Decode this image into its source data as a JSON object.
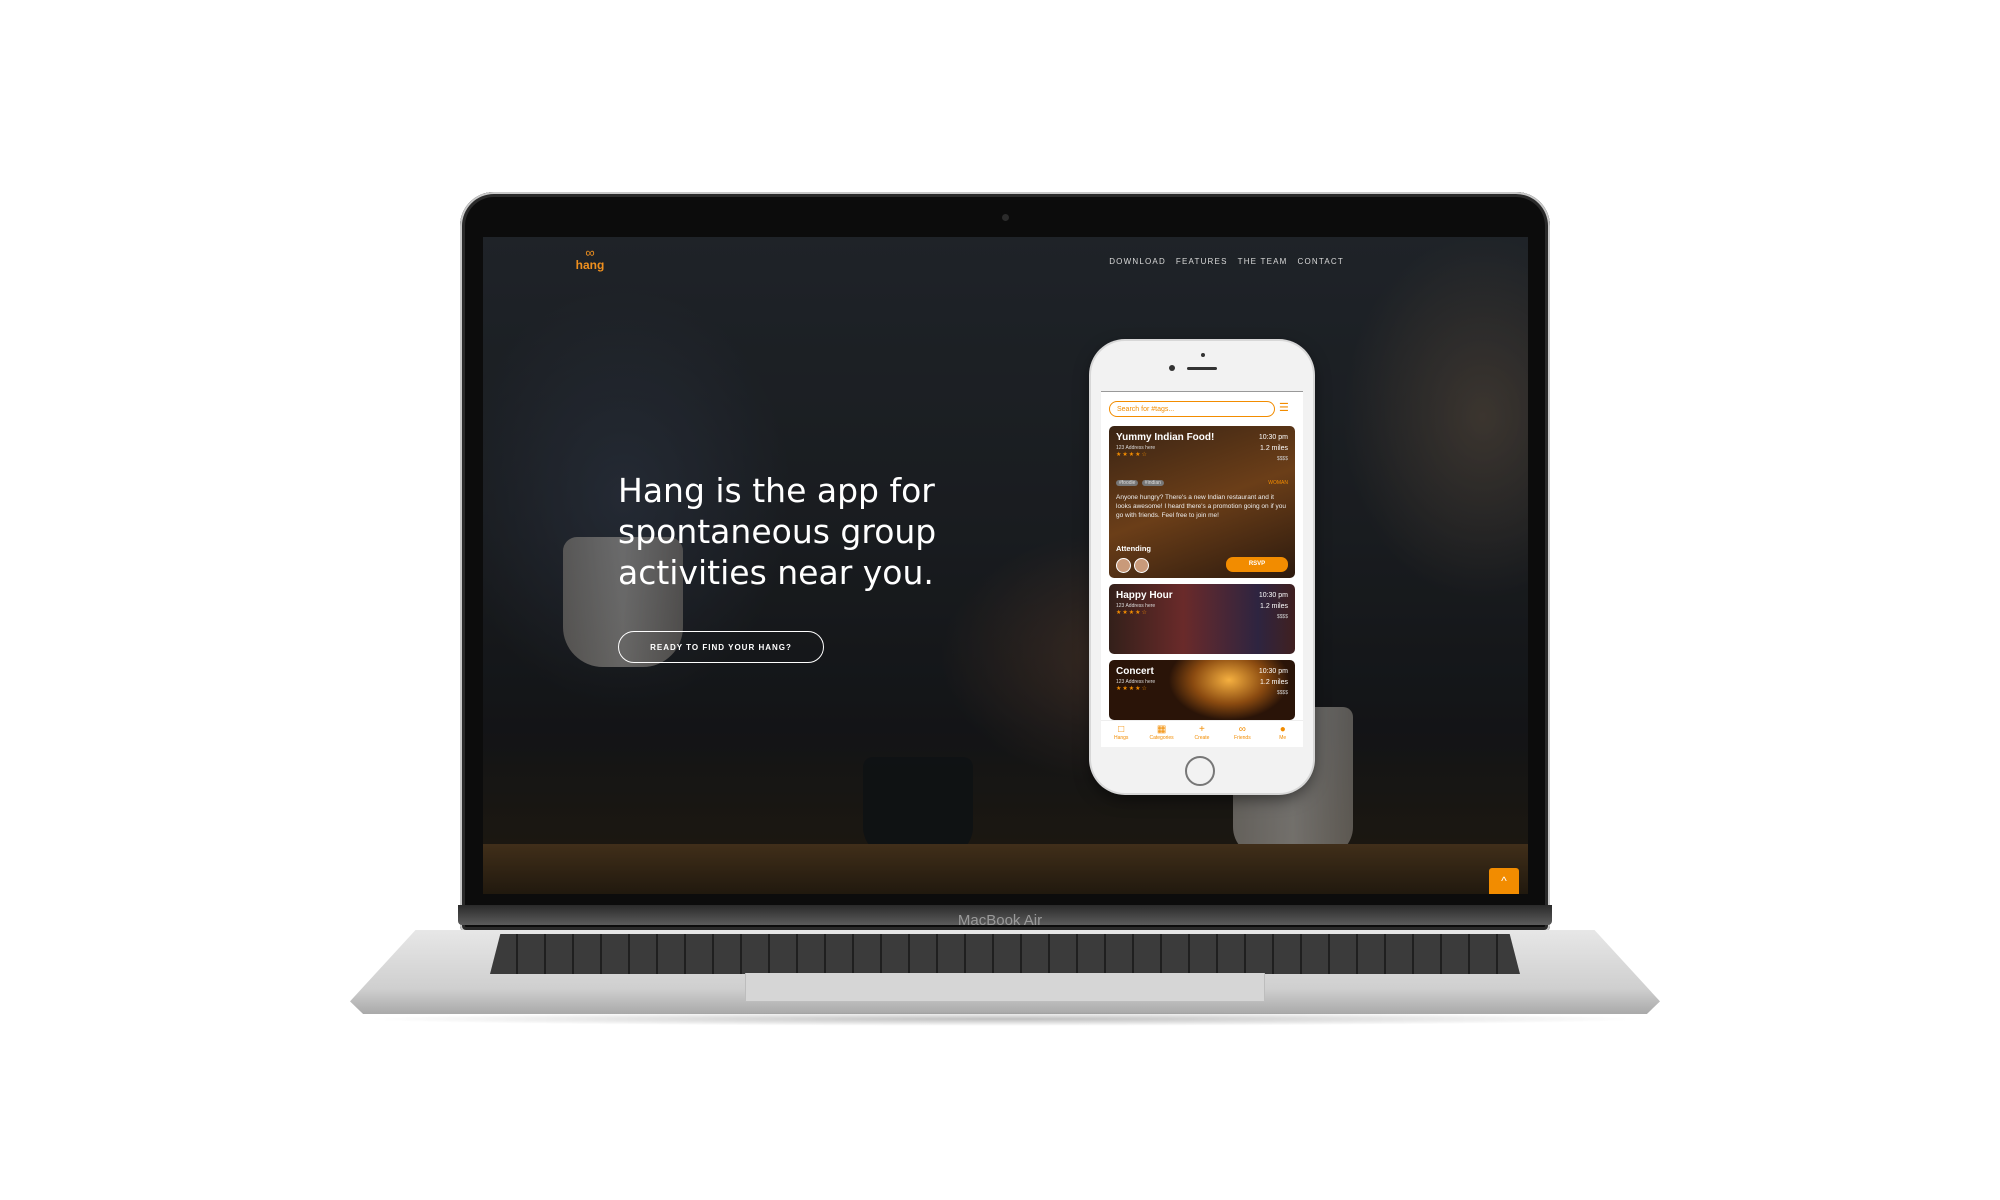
{
  "device": {
    "label": "MacBook Air"
  },
  "site": {
    "logo_text": "hang",
    "logo_icon": "people-icon",
    "nav": [
      "DOWNLOAD",
      "FEATURES",
      "THE TEAM",
      "CONTACT"
    ],
    "hero_title": "Hang is the app for spontaneous group activities near you.",
    "cta_label": "READY TO FIND YOUR HANG?",
    "scroll_top_icon": "^"
  },
  "app": {
    "search_placeholder": "Search for #tags...",
    "cards": [
      {
        "title": "Yummy Indian Food!",
        "time": "10:30 pm",
        "distance": "1.2 miles",
        "price": "$$$$",
        "address": "123 Address here",
        "stars": "★★★★☆",
        "tags": [
          "#foodie",
          "#indian"
        ],
        "host": "WOMAN",
        "description": "Anyone hungry? There's a new Indian restaurant and it looks awesome! I heard there's a promotion going on if you go with friends. Feel free to join me!",
        "attending_label": "Attending",
        "rsvp_label": "RSVP"
      },
      {
        "title": "Happy Hour",
        "time": "10:30 pm",
        "distance": "1.2 miles",
        "price": "$$$$",
        "address": "123 Address here",
        "stars": "★★★★☆"
      },
      {
        "title": "Concert",
        "time": "10:30 pm",
        "distance": "1.2 miles",
        "price": "$$$$",
        "address": "123 Address here",
        "stars": "★★★★☆"
      }
    ],
    "tabs": [
      {
        "label": "Hangs",
        "icon": "calendar-icon"
      },
      {
        "label": "Categories",
        "icon": "grid-icon"
      },
      {
        "label": "Create",
        "icon": "plus-icon"
      },
      {
        "label": "Friends",
        "icon": "friends-icon"
      },
      {
        "label": "Me",
        "icon": "avatar-icon"
      }
    ]
  },
  "colors": {
    "accent": "#f28c00",
    "background": "#ffffff"
  }
}
